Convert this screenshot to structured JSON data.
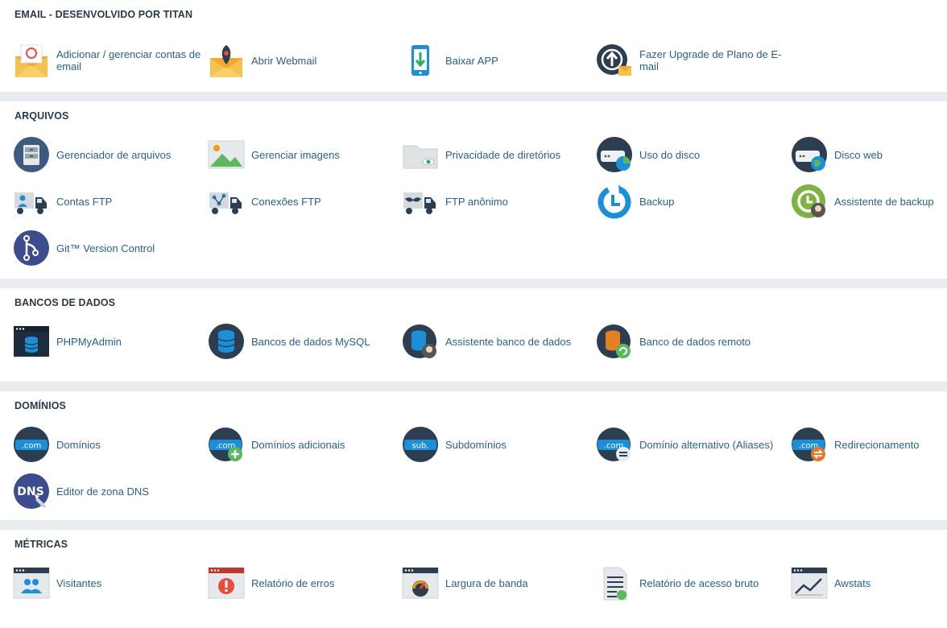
{
  "sections": [
    {
      "id": "email",
      "title": "EMAIL - DESENVOLVIDO POR TITAN",
      "items": [
        {
          "label": "Adicionar / gerenciar contas de email",
          "icon": "email-accounts-icon"
        },
        {
          "label": "Abrir Webmail",
          "icon": "webmail-icon"
        },
        {
          "label": "Baixar APP",
          "icon": "download-app-icon"
        },
        {
          "label": "Fazer Upgrade de Plano de E-mail",
          "icon": "upgrade-plan-icon"
        }
      ]
    },
    {
      "id": "arquivos",
      "title": "ARQUIVOS",
      "items": [
        {
          "label": "Gerenciador de arquivos",
          "icon": "file-manager-icon"
        },
        {
          "label": "Gerenciar imagens",
          "icon": "images-icon"
        },
        {
          "label": "Privacidade de diretórios",
          "icon": "directory-privacy-icon"
        },
        {
          "label": "Uso do disco",
          "icon": "disk-usage-icon"
        },
        {
          "label": "Disco web",
          "icon": "web-disk-icon"
        },
        {
          "label": "Contas FTP",
          "icon": "ftp-accounts-icon"
        },
        {
          "label": "Conexões FTP",
          "icon": "ftp-connections-icon"
        },
        {
          "label": "FTP anônimo",
          "icon": "anonymous-ftp-icon"
        },
        {
          "label": "Backup",
          "icon": "backup-icon"
        },
        {
          "label": "Assistente de backup",
          "icon": "backup-wizard-icon"
        },
        {
          "label": "Git™ Version Control",
          "icon": "git-icon"
        }
      ]
    },
    {
      "id": "bancos",
      "title": "BANCOS DE DADOS",
      "items": [
        {
          "label": "PHPMyAdmin",
          "icon": "phpmyadmin-icon"
        },
        {
          "label": "Bancos de dados MySQL",
          "icon": "mysql-database-icon"
        },
        {
          "label": "Assistente banco de dados",
          "icon": "database-wizard-icon"
        },
        {
          "label": "Banco de dados remoto",
          "icon": "remote-database-icon"
        }
      ]
    },
    {
      "id": "dominios",
      "title": "DOMÍNIOS",
      "items": [
        {
          "label": "Domínios",
          "icon": "domains-icon"
        },
        {
          "label": "Domínios adicionais",
          "icon": "addon-domains-icon"
        },
        {
          "label": "Subdomínios",
          "icon": "subdomains-icon"
        },
        {
          "label": "Domínio alternativo (Aliases)",
          "icon": "aliases-icon"
        },
        {
          "label": "Redirecionamento",
          "icon": "redirects-icon"
        },
        {
          "label": "Editor de zona DNS",
          "icon": "dns-zone-editor-icon"
        }
      ]
    },
    {
      "id": "metricas",
      "title": "MÉTRICAS",
      "items": [
        {
          "label": "Visitantes",
          "icon": "visitors-icon"
        },
        {
          "label": "Relatório de erros",
          "icon": "errors-icon"
        },
        {
          "label": "Largura de banda",
          "icon": "bandwidth-icon"
        },
        {
          "label": "Relatório de acesso bruto",
          "icon": "raw-access-icon"
        },
        {
          "label": "Awstats",
          "icon": "awstats-icon"
        }
      ]
    }
  ],
  "icon_text": {
    "com": ".com",
    "sub": "sub.",
    "dns": "DNS"
  },
  "colors": {
    "section_title": "#293a4a",
    "link": "#295f8c",
    "separator": "#e8edf2",
    "icon_navy": "#2d3e50",
    "icon_blue": "#1b8fd8",
    "icon_orange": "#f39c12",
    "icon_green": "#5cb85c",
    "icon_red": "#e74c3c"
  }
}
